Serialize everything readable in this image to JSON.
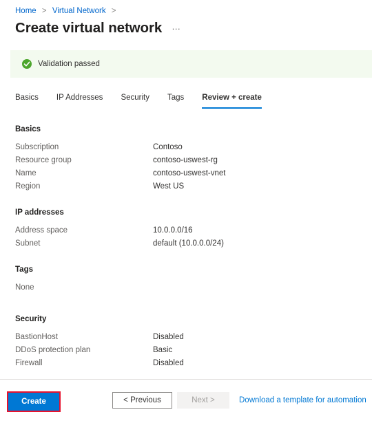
{
  "breadcrumb": {
    "items": [
      "Home",
      "Virtual Network"
    ],
    "separator": ">"
  },
  "header": {
    "title": "Create virtual network",
    "more_label": "…"
  },
  "banner": {
    "icon": "check-circle-icon",
    "text": "Validation passed",
    "background": "#f3faef",
    "icon_color": "#4ca62c"
  },
  "tabs": [
    {
      "label": "Basics",
      "active": false
    },
    {
      "label": "IP Addresses",
      "active": false
    },
    {
      "label": "Security",
      "active": false
    },
    {
      "label": "Tags",
      "active": false
    },
    {
      "label": "Review + create",
      "active": true
    }
  ],
  "sections": {
    "basics": {
      "title": "Basics",
      "rows": [
        {
          "key": "Subscription",
          "value": "Contoso"
        },
        {
          "key": "Resource group",
          "value": "contoso-uswest-rg"
        },
        {
          "key": "Name",
          "value": "contoso-uswest-vnet"
        },
        {
          "key": "Region",
          "value": "West US"
        }
      ]
    },
    "ip_addresses": {
      "title": "IP addresses",
      "rows": [
        {
          "key": "Address space",
          "value": "10.0.0.0/16"
        },
        {
          "key": "Subnet",
          "value": "default (10.0.0.0/24)"
        }
      ]
    },
    "tags": {
      "title": "Tags",
      "empty_text": "None"
    },
    "security": {
      "title": "Security",
      "rows": [
        {
          "key": "BastionHost",
          "value": "Disabled"
        },
        {
          "key": "DDoS protection plan",
          "value": "Basic"
        },
        {
          "key": "Firewall",
          "value": "Disabled"
        }
      ]
    }
  },
  "footer": {
    "create_label": "Create",
    "previous_label": "< Previous",
    "next_label": "Next >",
    "template_link_label": "Download a template for automation",
    "accent_color": "#0078d4",
    "highlight_color": "#e8112d"
  }
}
